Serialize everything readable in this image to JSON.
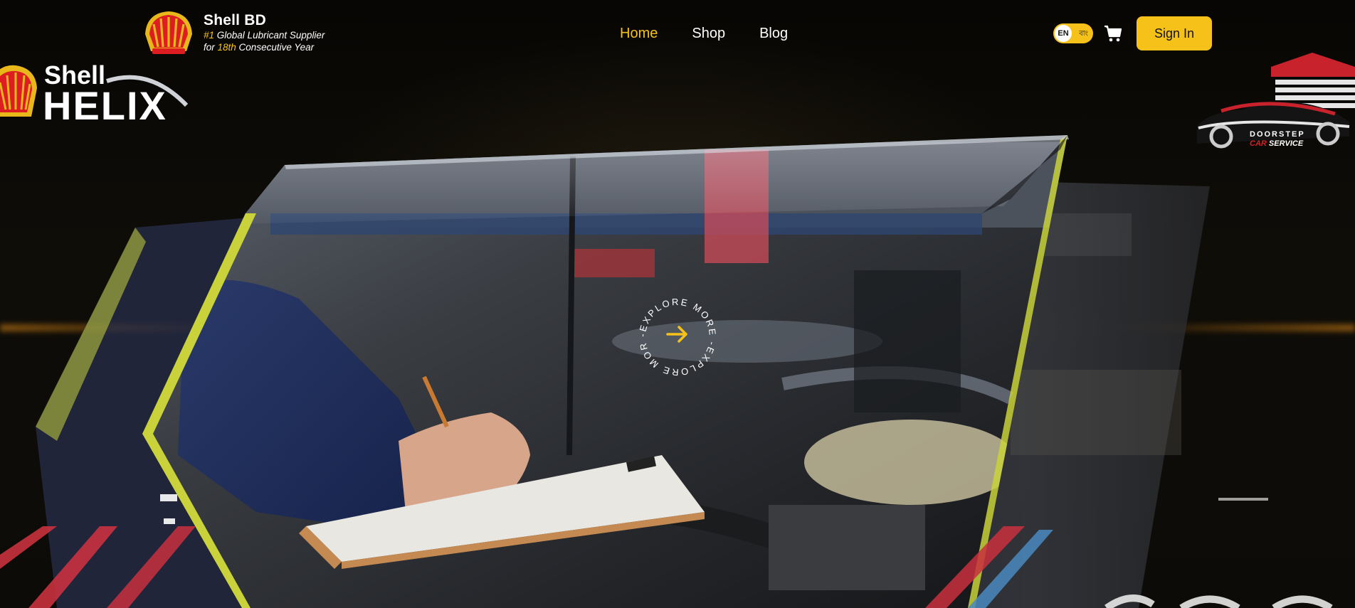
{
  "brand": {
    "name": "Shell BD",
    "tagline": {
      "rank": "#1",
      "line1_rest": " Global Lubricant Supplier",
      "for": "for ",
      "years": "18th",
      "line2_rest": " Consecutive Year"
    },
    "logo_icon": "shell-pecten-icon"
  },
  "nav": {
    "items": [
      {
        "label": "Home",
        "active": true
      },
      {
        "label": "Shop",
        "active": false
      },
      {
        "label": "Blog",
        "active": false
      }
    ]
  },
  "language": {
    "current": "EN",
    "alternate": "বাং"
  },
  "cart": {
    "icon": "cart-icon"
  },
  "auth": {
    "signin_label": "Sign In"
  },
  "helix": {
    "word_top": "Shell",
    "word_main": "HELIX"
  },
  "doorstep": {
    "line1": "DOORSTEP",
    "line2_accent": "CAR",
    "line2_rest": " SERVICE"
  },
  "hero": {
    "explore_text": "-EXPLORE MORE -EXPLORE MORE ",
    "explore_icon": "arrow-right-icon"
  },
  "colors": {
    "accent": "#f6c21a",
    "shell_red": "#dd1d21",
    "background": "#0b0a07",
    "panel_edge": "#c9d23a"
  }
}
